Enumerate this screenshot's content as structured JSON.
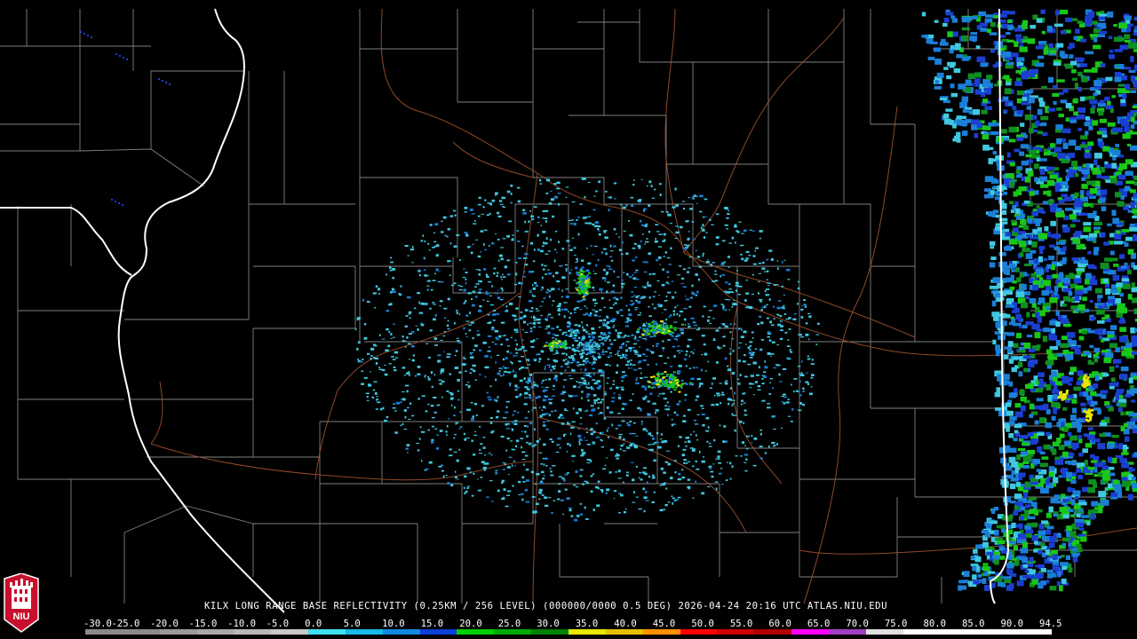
{
  "product": {
    "caption": "KILX LONG RANGE BASE REFLECTIVITY (0.25KM / 256 LEVEL) (000000/0000 0.5 DEG) 2026-04-24 20:16 UTC  ATLAS.NIU.EDU",
    "logo_text": "NIU"
  },
  "scale": {
    "labels": [
      "-30.0",
      "-25.0",
      "-20.0",
      "-15.0",
      "-10.0",
      "-5.0",
      "0.0",
      "5.0",
      "10.0",
      "15.0",
      "20.0",
      "25.0",
      "30.0",
      "35.0",
      "40.0",
      "45.0",
      "50.0",
      "55.0",
      "60.0",
      "65.0",
      "70.0",
      "75.0",
      "80.0",
      "85.0",
      "90.0",
      "94.5"
    ],
    "colors": [
      "#8a8a8a",
      "#8a8a8a",
      "#9a9a9a",
      "#a8a8a8",
      "#b8b8b8",
      "#c8c8c8",
      "#40e0f0",
      "#18b8e8",
      "#1488e0",
      "#0a3fd8",
      "#00d000",
      "#00a800",
      "#008000",
      "#e8e800",
      "#e8c000",
      "#ff9000",
      "#ff0000",
      "#d00000",
      "#b00000",
      "#ff00ff",
      "#a040c0",
      "#e0e0e0",
      "#ffffff",
      "#ffffff",
      "#ffffff",
      "#ffffff"
    ]
  },
  "map": {
    "colors": {
      "background": "#000000",
      "county_border": "#808080",
      "state_border": "#ffffff",
      "highway": "#a0522d",
      "echo_light": "#3fc8e0",
      "echo_mid": "#1a7fd8",
      "echo_blue": "#1a3fd0",
      "echo_green": "#18c818",
      "echo_dkgreen": "#0f8f20",
      "echo_yellow": "#e8e800"
    }
  }
}
